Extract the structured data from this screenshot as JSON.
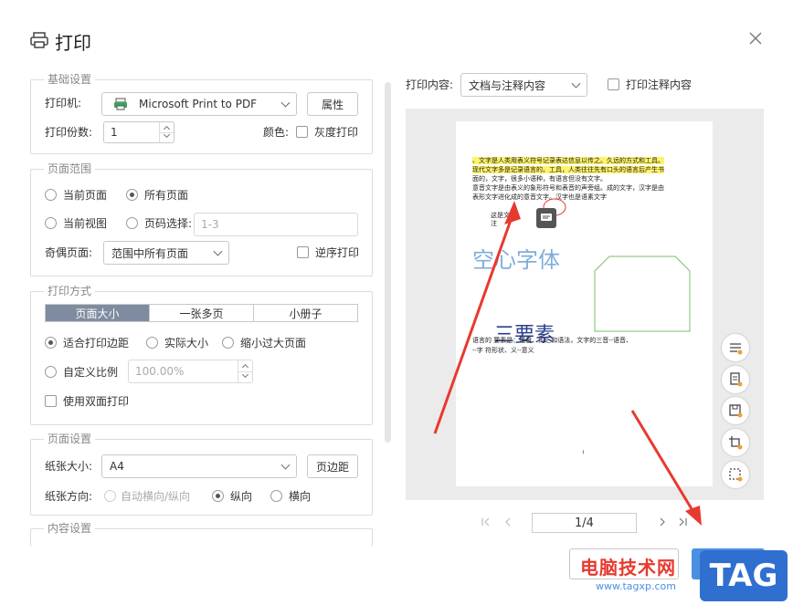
{
  "dialog": {
    "title": "打印"
  },
  "basic": {
    "legend": "基础设置",
    "printer_label": "打印机:",
    "printer_value": "Microsoft Print to PDF",
    "properties_button": "属性",
    "copies_label": "打印份数:",
    "copies_value": "1",
    "color_label": "颜色:",
    "grayscale_label": "灰度打印"
  },
  "range": {
    "legend": "页面范围",
    "current_page": "当前页面",
    "all_pages": "所有页面",
    "current_view": "当前视图",
    "page_select": "页码选择:",
    "page_select_placeholder": "1-3",
    "odd_even_label": "奇偶页面:",
    "odd_even_value": "范围中所有页面",
    "reverse_label": "逆序打印"
  },
  "mode": {
    "legend": "打印方式",
    "tabs": [
      "页面大小",
      "一张多页",
      "小册子"
    ],
    "fit_margin": "适合打印边距",
    "actual_size": "实际大小",
    "shrink_large": "缩小过大页面",
    "custom_scale": "自定义比例",
    "custom_scale_value": "100.00%",
    "duplex": "使用双面打印"
  },
  "page_setup": {
    "legend": "页面设置",
    "paper_label": "纸张大小:",
    "paper_value": "A4",
    "margin_button": "页边距",
    "orientation_label": "纸张方向:",
    "auto": "自动横向/纵向",
    "portrait": "纵向",
    "landscape": "横向"
  },
  "content_setup": {
    "legend": "内容设置"
  },
  "preview": {
    "content_label": "打印内容:",
    "content_value": "文档与注释内容",
    "print_annotations": "打印注释内容",
    "page_indicator": "1/4",
    "doc": {
      "line1": "、文字是人类用表义符号记录表达信息以传之。久远的方式和工具。",
      "line2": "现代文字多是记录语言的。工具，人类往往先有口头的语言后产生书",
      "line3": "面的，文字，很多小语种，有语言但没有文字。",
      "line4": "意音文字是由表义的象形符号和表音的声旁组。成的文字，汉字是由",
      "line5": "表形文字进化成的意音文字。汉字也是语素文字",
      "small1": "这是文",
      "small2": "注",
      "big1": "空心字体",
      "big2": "三要素",
      "lang_line1": "语言的 要素是：语音、词汇和语法，文字的三音--语音、",
      "lang_line2": "--字 符形状、义--意义",
      "page_number": "1"
    }
  },
  "watermark": {
    "site_name": "电脑技术网",
    "url": "www.tagxp.com",
    "tag": "TAG"
  },
  "colors": {
    "accent_tab": "#7f8ba0",
    "annotation_red": "#e8392f",
    "wordart": "#6b9fd4",
    "shape_green": "#7bbf6a"
  }
}
